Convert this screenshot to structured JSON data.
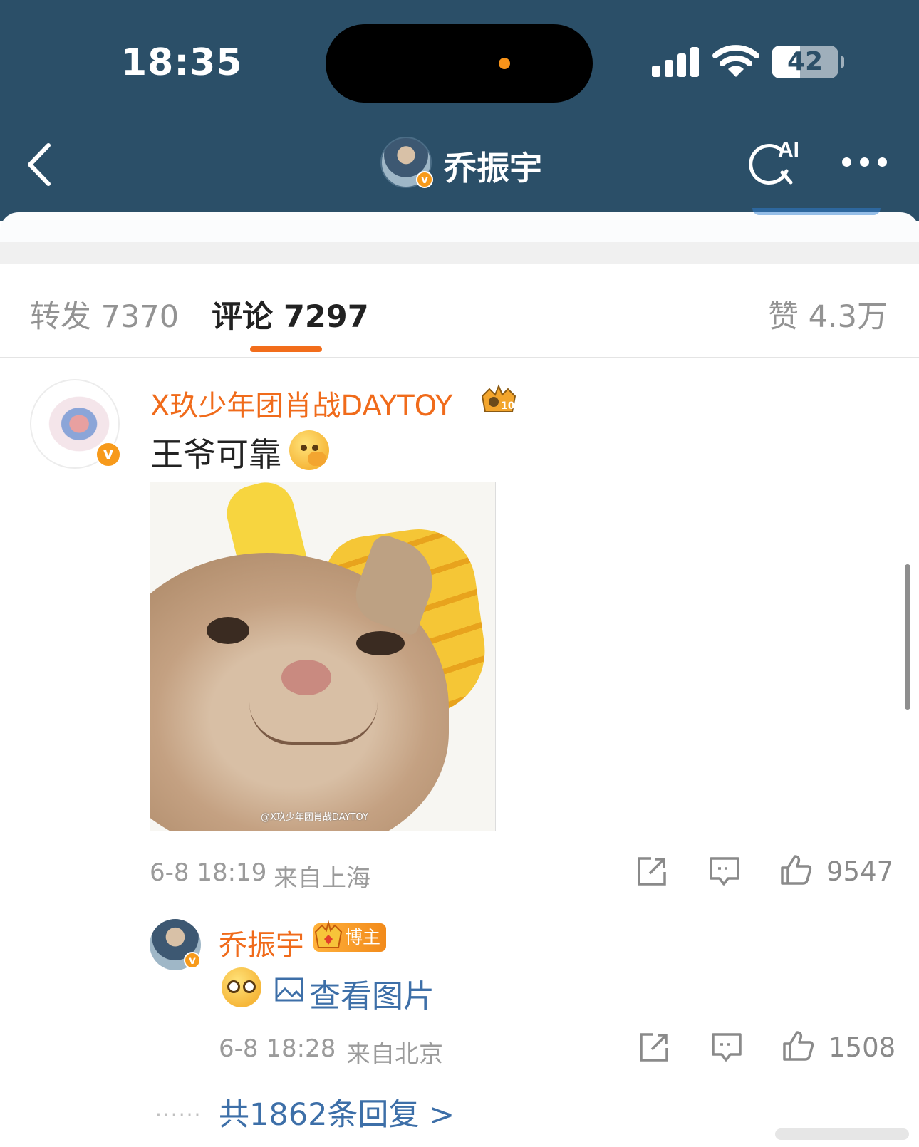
{
  "status_bar": {
    "time": "18:35",
    "battery": "42"
  },
  "nav": {
    "title": "乔振宇",
    "ai_label": "AI"
  },
  "tabs": [
    {
      "label": "转发 7370",
      "active": false
    },
    {
      "label": "评论 7297",
      "active": true
    },
    {
      "label": "赞 4.3万",
      "active": false
    }
  ],
  "comment": {
    "username": "X玖少年团肖战DAYTOY",
    "text": "王爷可靠",
    "image_watermark": "@X玖少年团肖战DAYTOY",
    "time": "6-8 18:19",
    "location": "来自上海",
    "likes": "9547",
    "badge_level": "10"
  },
  "reply": {
    "username": "乔振宇",
    "badge": "博主",
    "view_image": "查看图片",
    "time": "6-8 18:28",
    "location": "来自北京",
    "likes": "1508"
  },
  "more_replies": "共1862条回复 >",
  "colors": {
    "header": "#2b4f68",
    "accent": "#f06b1b",
    "link": "#3d6fa8"
  }
}
